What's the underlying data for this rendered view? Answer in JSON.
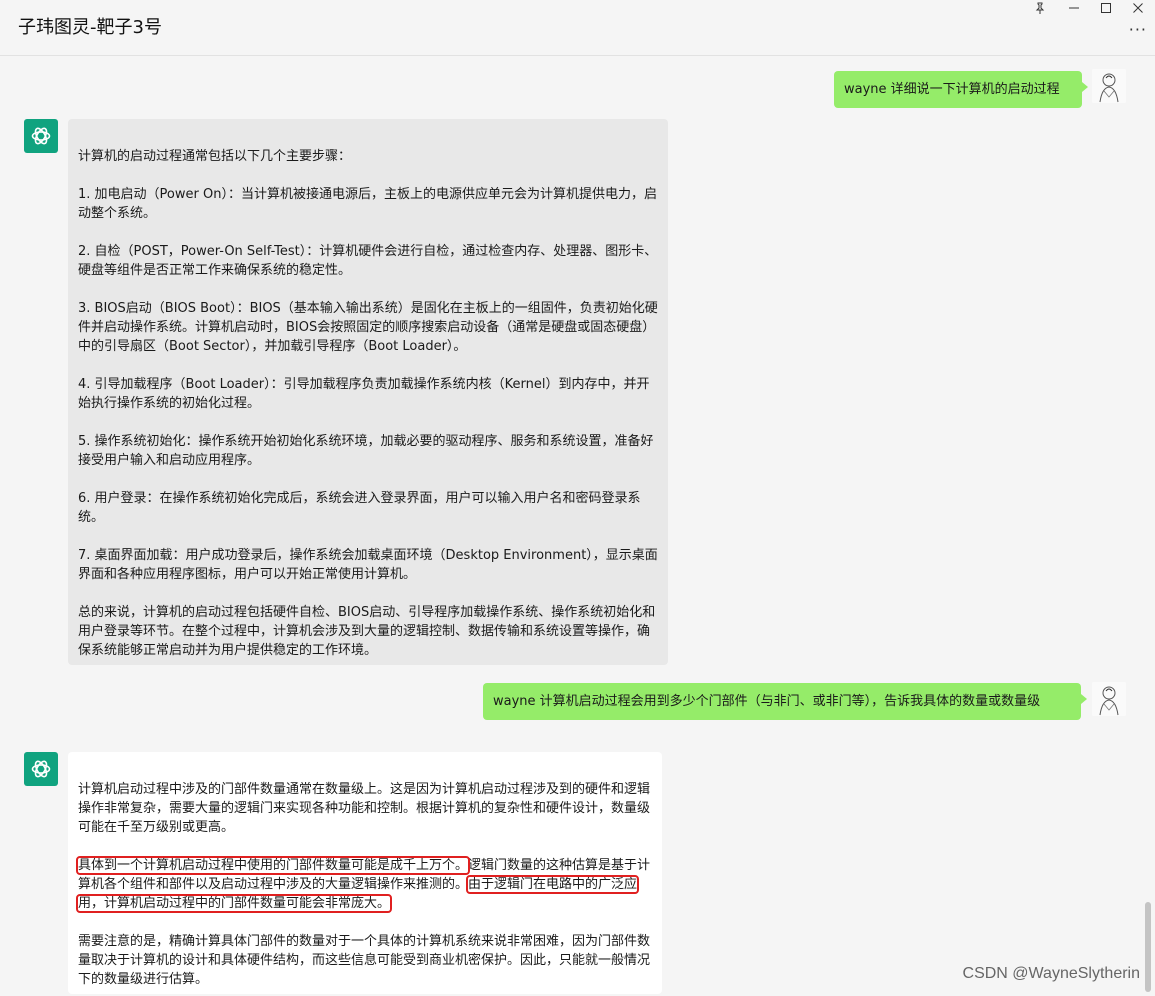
{
  "window": {
    "title": "子玮图灵-靶子3号",
    "pin_icon": "pin-icon",
    "minimize_icon": "minimize-icon",
    "maximize_icon": "maximize-icon",
    "close_icon": "close-icon",
    "more_label": "···"
  },
  "messages": {
    "user1": {
      "text": "wayne 详细说一下计算机的启动过程"
    },
    "bot1": {
      "paragraphs": [
        "计算机的启动过程通常包括以下几个主要步骤：",
        "1. 加电启动（Power On）：当计算机被接通电源后，主板上的电源供应单元会为计算机提供电力，启动整个系统。",
        "2. 自检（POST，Power-On Self-Test）：计算机硬件会进行自检，通过检查内存、处理器、图形卡、硬盘等组件是否正常工作来确保系统的稳定性。",
        "3. BIOS启动（BIOS Boot）：BIOS（基本输入输出系统）是固化在主板上的一组固件，负责初始化硬件并启动操作系统。计算机启动时，BIOS会按照固定的顺序搜索启动设备（通常是硬盘或固态硬盘）中的引导扇区（Boot Sector），并加载引导程序（Boot Loader）。",
        "4. 引导加载程序（Boot Loader）：引导加载程序负责加载操作系统内核（Kernel）到内存中，并开始执行操作系统的初始化过程。",
        "5. 操作系统初始化：操作系统开始初始化系统环境，加载必要的驱动程序、服务和系统设置，准备好接受用户输入和启动应用程序。",
        "6. 用户登录：在操作系统初始化完成后，系统会进入登录界面，用户可以输入用户名和密码登录系统。",
        "7. 桌面界面加载：用户成功登录后，操作系统会加载桌面环境（Desktop Environment），显示桌面界面和各种应用程序图标，用户可以开始正常使用计算机。",
        "总的来说，计算机的启动过程包括硬件自检、BIOS启动、引导程序加载操作系统、操作系统初始化和用户登录等环节。在整个过程中，计算机会涉及到大量的逻辑控制、数据传输和系统设置等操作，确保系统能够正常启动并为用户提供稳定的工作环境。"
      ]
    },
    "user2": {
      "text": "wayne 计算机启动过程会用到多少个门部件（与非门、或非门等），告诉我具体的数量或数量级"
    },
    "bot2": {
      "p1": "计算机启动过程中涉及的门部件数量通常在数量级上。这是因为计算机启动过程涉及到的硬件和逻辑操作非常复杂，需要大量的逻辑门来实现各种功能和控制。根据计算机的复杂性和硬件设计，数量级可能在千至万级别或更高。",
      "p2_hl1": "具体到一个计算机启动过程中使用的门部件数量可能是成千上万个。",
      "p2_mid": "逻辑门数量的这种估算是基于计算机各个组件和部件以及启动过程中涉及的大量逻辑操作来推测的。",
      "p2_hl2": "由于逻辑门在电路中的广泛应用，计算机启动过程中的门部件数量可能会非常庞大。",
      "p3": "需要注意的是，精确计算具体门部件的数量对于一个具体的计算机系统来说非常困难，因为门部件数量取决于计算机的设计和具体硬件结构，而这些信息可能受到商业机密保护。因此，只能就一般情况下的数量级进行估算。"
    }
  },
  "watermark": "CSDN @WayneSlytherin",
  "colors": {
    "user_bubble": "#95ec69",
    "bot_bubble_gray": "#e8e8e8",
    "bot_bubble_white": "#ffffff",
    "bot_avatar": "#10a37f",
    "highlight_box": "#e02020"
  }
}
